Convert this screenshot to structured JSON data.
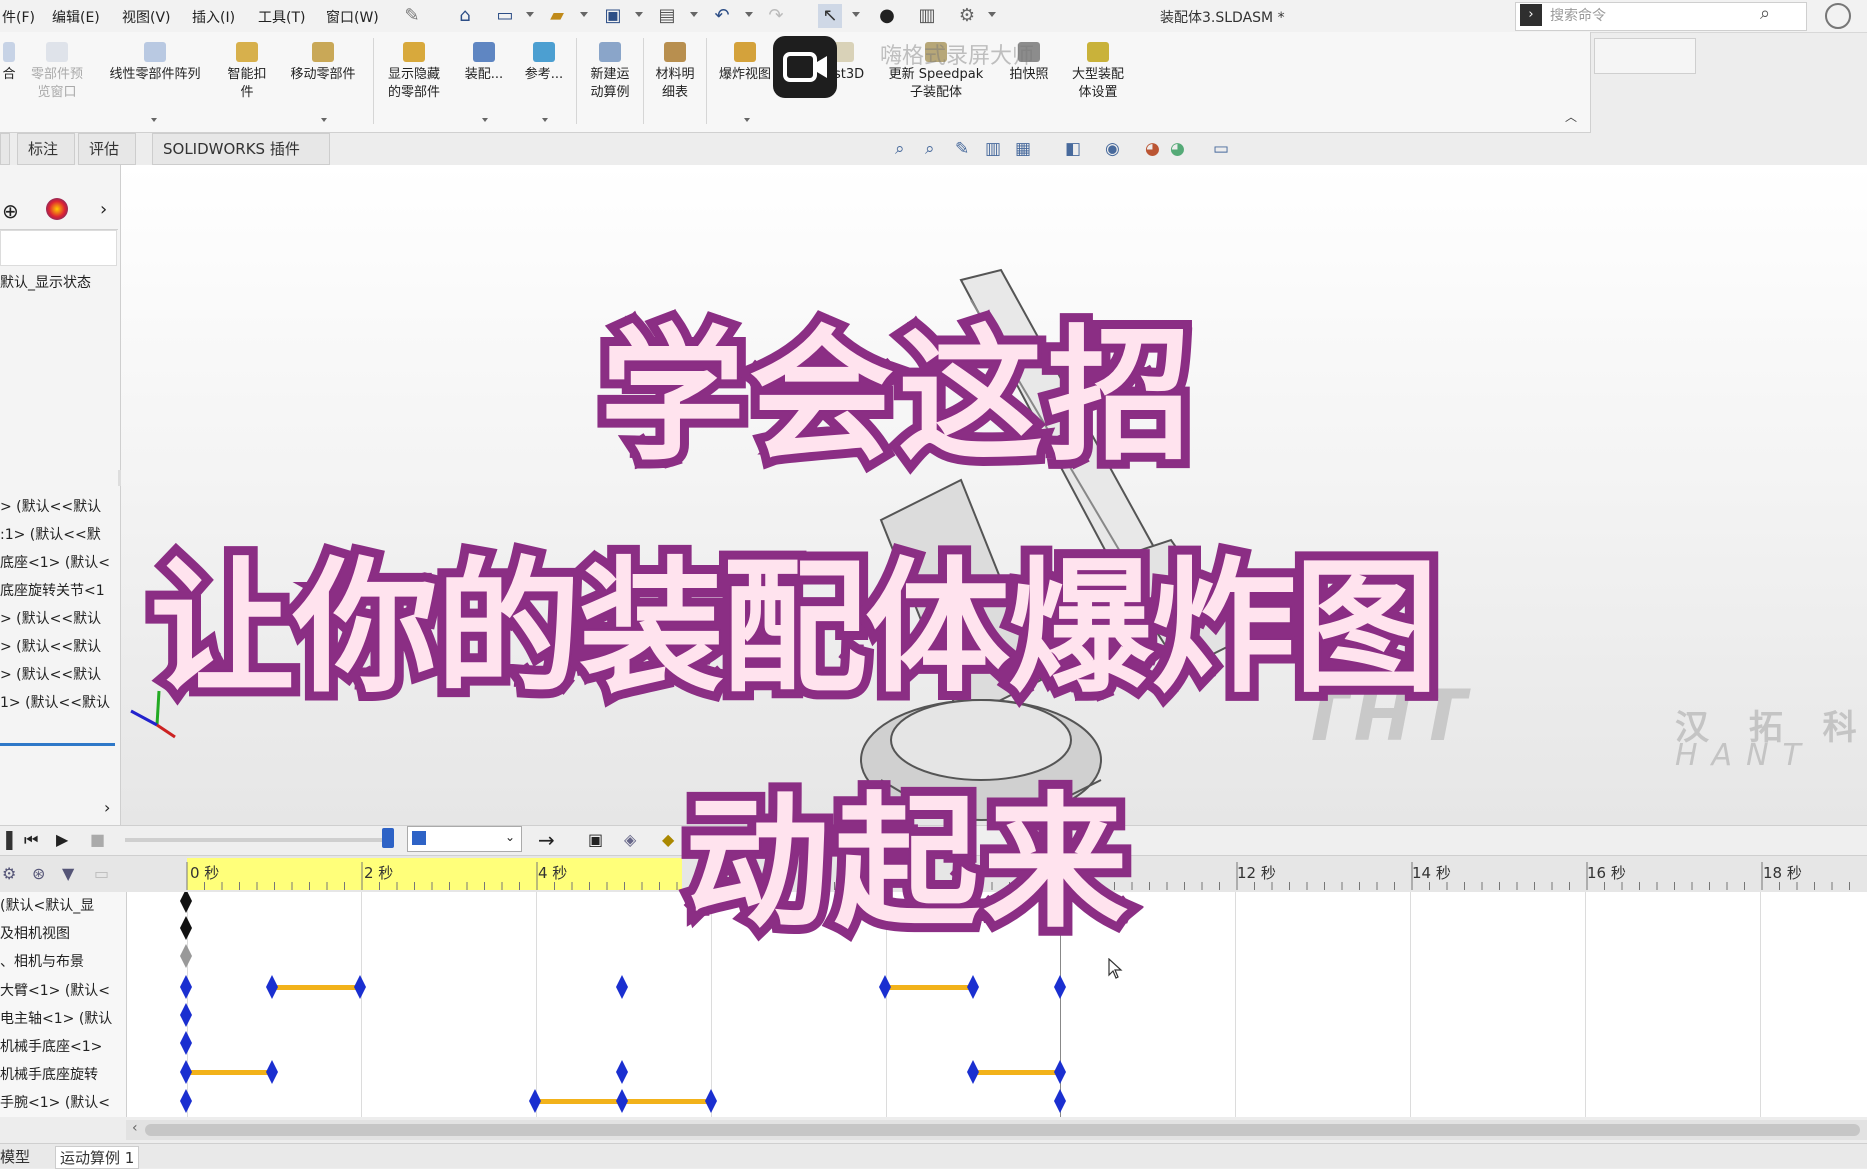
{
  "menubar": {
    "items": [
      "件(F)",
      "编辑(E)",
      "视图(V)",
      "插入(I)",
      "工具(T)",
      "窗口(W)"
    ],
    "document_title": "装配体3.SLDASM *",
    "search_placeholder": "搜索命令"
  },
  "ribbon": {
    "buttons": [
      {
        "label": "合",
        "icon": "assembly-icon"
      },
      {
        "label": "零部件预\n览窗口",
        "icon": "preview-window-icon"
      },
      {
        "label": "线性零部件阵列",
        "icon": "linear-pattern-icon"
      },
      {
        "label": "智能扣\n件",
        "icon": "smart-fastener-icon"
      },
      {
        "label": "移动零部件",
        "icon": "move-component-icon"
      },
      {
        "label": "显示隐藏\n的零部件",
        "icon": "show-hidden-icon"
      },
      {
        "label": "装配...",
        "icon": "assembly-feature-icon"
      },
      {
        "label": "参考...",
        "icon": "reference-icon"
      },
      {
        "label": "新建运\n动算例",
        "icon": "new-motion-study-icon"
      },
      {
        "label": "材料明\n细表",
        "icon": "bom-icon"
      },
      {
        "label": "爆炸视图",
        "icon": "exploded-view-icon"
      },
      {
        "label": "Inst3D",
        "icon": "instant3d-icon"
      },
      {
        "label": "更新 Speedpak\n子装配体",
        "icon": "speedpak-icon"
      },
      {
        "label": "拍快照",
        "icon": "snapshot-icon"
      },
      {
        "label": "大型装配\n体设置",
        "icon": "large-assembly-icon"
      }
    ]
  },
  "tabs": [
    "",
    "标注",
    "评估",
    "SOLIDWORKS 插件"
  ],
  "left_panel": {
    "display_state": "默认_显示状态",
    "items": [
      "> (默认<<默认",
      ":1> (默认<<默",
      "底座<1> (默认<",
      "底座旋转关节<1",
      "> (默认<<默认",
      "> (默认<<默认",
      "> (默认<<默认",
      "1> (默认<<默认"
    ]
  },
  "watermark": {
    "letters": "THT",
    "chinese": "汉 拓 科",
    "english": "HANT"
  },
  "recorder_watermark": "嗨格式录屏大师",
  "timeline": {
    "ruler": [
      "0 秒",
      "2 秒",
      "4 秒",
      "12 秒",
      "14 秒",
      "16 秒",
      "18 秒"
    ],
    "rows": [
      "(默认<默认_显",
      "及相机视图",
      "、相机与布景",
      "大臂<1> (默认<",
      "电主轴<1> (默认",
      "机械手底座<1>",
      "机械手底座旋转",
      "手腕<1> (默认<"
    ],
    "select_value": ""
  },
  "bottom_tabs": [
    "模型",
    "运动算例 1"
  ],
  "caption": {
    "line1": "学会这招",
    "line2": "让你的装配体爆炸图",
    "line3": "动起来"
  },
  "colors": {
    "caption_fill": "#ffe3ee",
    "caption_stroke": "#8b2e84",
    "keyframe": "#1a2fd0",
    "bar": "#f2b21a",
    "ruler_highlight": "#ffff7a"
  }
}
